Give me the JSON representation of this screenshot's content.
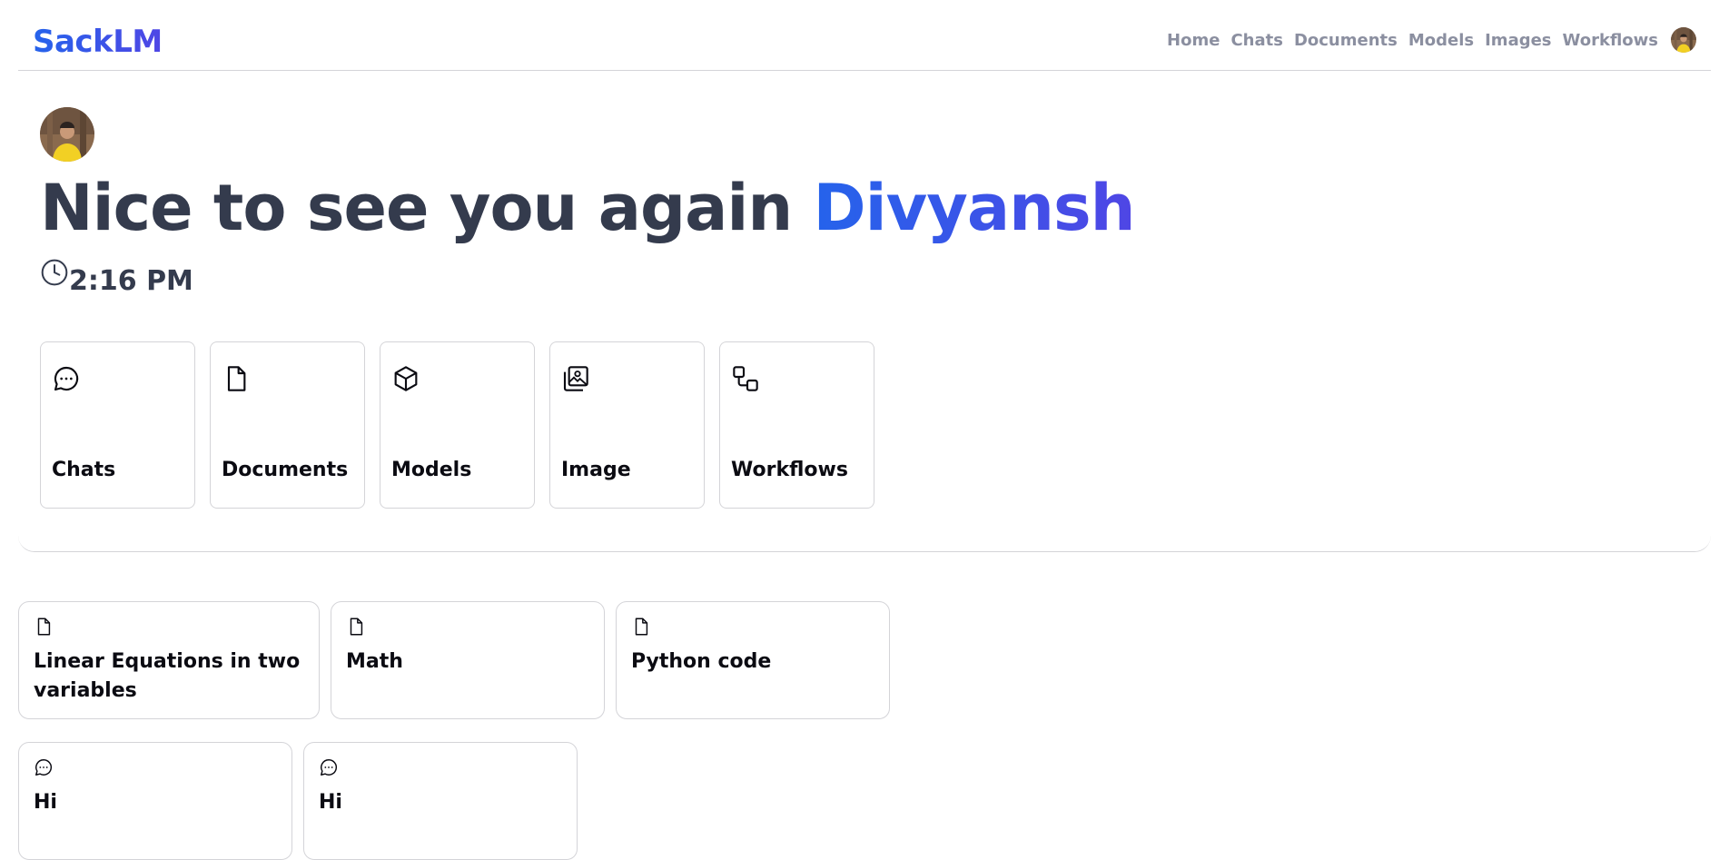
{
  "app": {
    "logo": "SackLM"
  },
  "nav": {
    "items": [
      {
        "label": "Home",
        "id": "home"
      },
      {
        "label": "Chats",
        "id": "chats"
      },
      {
        "label": "Documents",
        "id": "documents"
      },
      {
        "label": "Models",
        "id": "models"
      },
      {
        "label": "Images",
        "id": "images"
      },
      {
        "label": "Workflows",
        "id": "workflows"
      }
    ]
  },
  "hero": {
    "greeting": "Nice to see you again",
    "user_name": "Divyansh",
    "time": "2:16 PM",
    "tiles": [
      {
        "label": "Chats",
        "icon": "chat-bubble-icon"
      },
      {
        "label": "Documents",
        "icon": "document-icon"
      },
      {
        "label": "Models",
        "icon": "cube-icon"
      },
      {
        "label": "Image",
        "icon": "images-icon"
      },
      {
        "label": "Workflows",
        "icon": "workflow-icon"
      }
    ]
  },
  "recent": {
    "documents": [
      {
        "title": "Linear Equations in two variables",
        "icon": "document-icon"
      },
      {
        "title": "Math",
        "icon": "document-icon"
      },
      {
        "title": "Python code",
        "icon": "document-icon"
      }
    ],
    "chats": [
      {
        "title": "Hi",
        "icon": "chat-bubble-icon"
      },
      {
        "title": "Hi",
        "icon": "chat-bubble-icon"
      }
    ]
  },
  "colors": {
    "accent": "#2563eb",
    "accent_end": "#4f46e5",
    "heading": "#343b4d",
    "nav_text": "#8b8fa0",
    "border": "#d4d4d8"
  }
}
